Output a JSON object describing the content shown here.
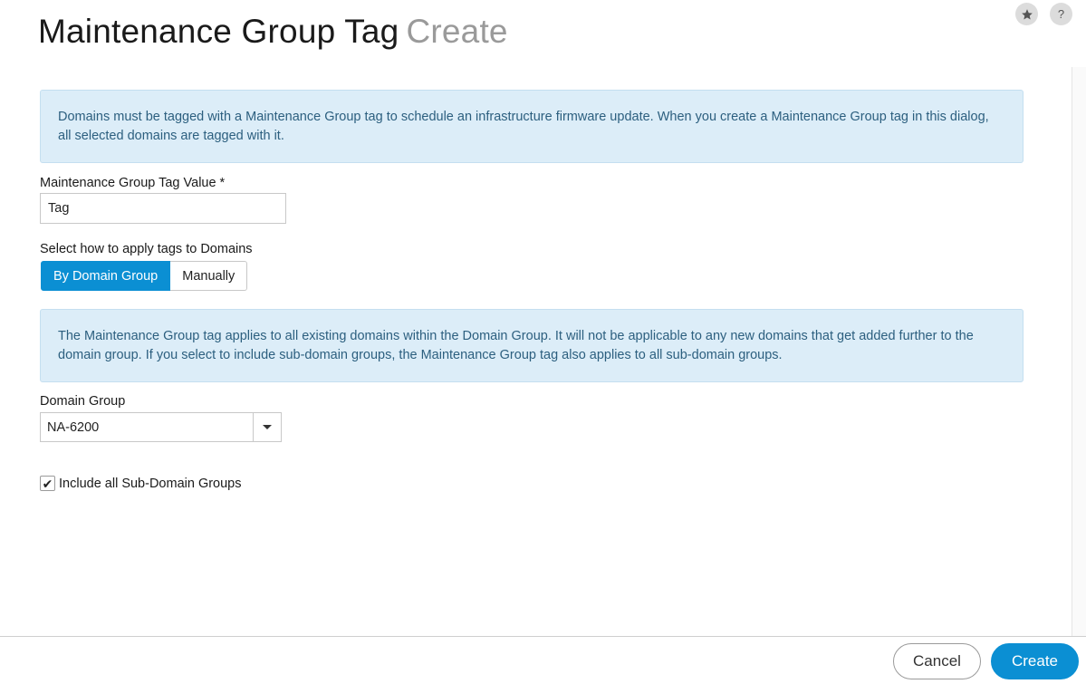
{
  "header": {
    "title": "Maintenance Group Tag",
    "subtitle": "Create",
    "star_icon": "star-icon",
    "help_label": "?"
  },
  "info_top": "Domains must be tagged with a Maintenance Group tag to schedule an infrastructure firmware update. When you create a Maintenance Group tag in this dialog, all selected domains are tagged with it.",
  "tag_field": {
    "label": "Maintenance Group Tag Value",
    "required_marker": "*",
    "value": "Tag"
  },
  "apply_mode": {
    "label": "Select how to apply tags to Domains",
    "options": [
      "By Domain Group",
      "Manually"
    ],
    "selected": "By Domain Group"
  },
  "info_domain_group": "The Maintenance Group tag applies to all existing domains within the Domain Group. It will not be applicable to any new domains that get added further to the domain group. If you select to include sub-domain groups, the Maintenance Group tag also applies to all sub-domain groups.",
  "domain_group": {
    "label": "Domain Group",
    "selected": "NA-6200"
  },
  "include_sub": {
    "label": "Include all Sub-Domain Groups",
    "checked": true,
    "check_glyph": "✔"
  },
  "footer": {
    "cancel_label": "Cancel",
    "create_label": "Create"
  },
  "colors": {
    "accent": "#0b8fd3",
    "info_bg": "#dcedf8",
    "info_text": "#2c5f7f"
  }
}
